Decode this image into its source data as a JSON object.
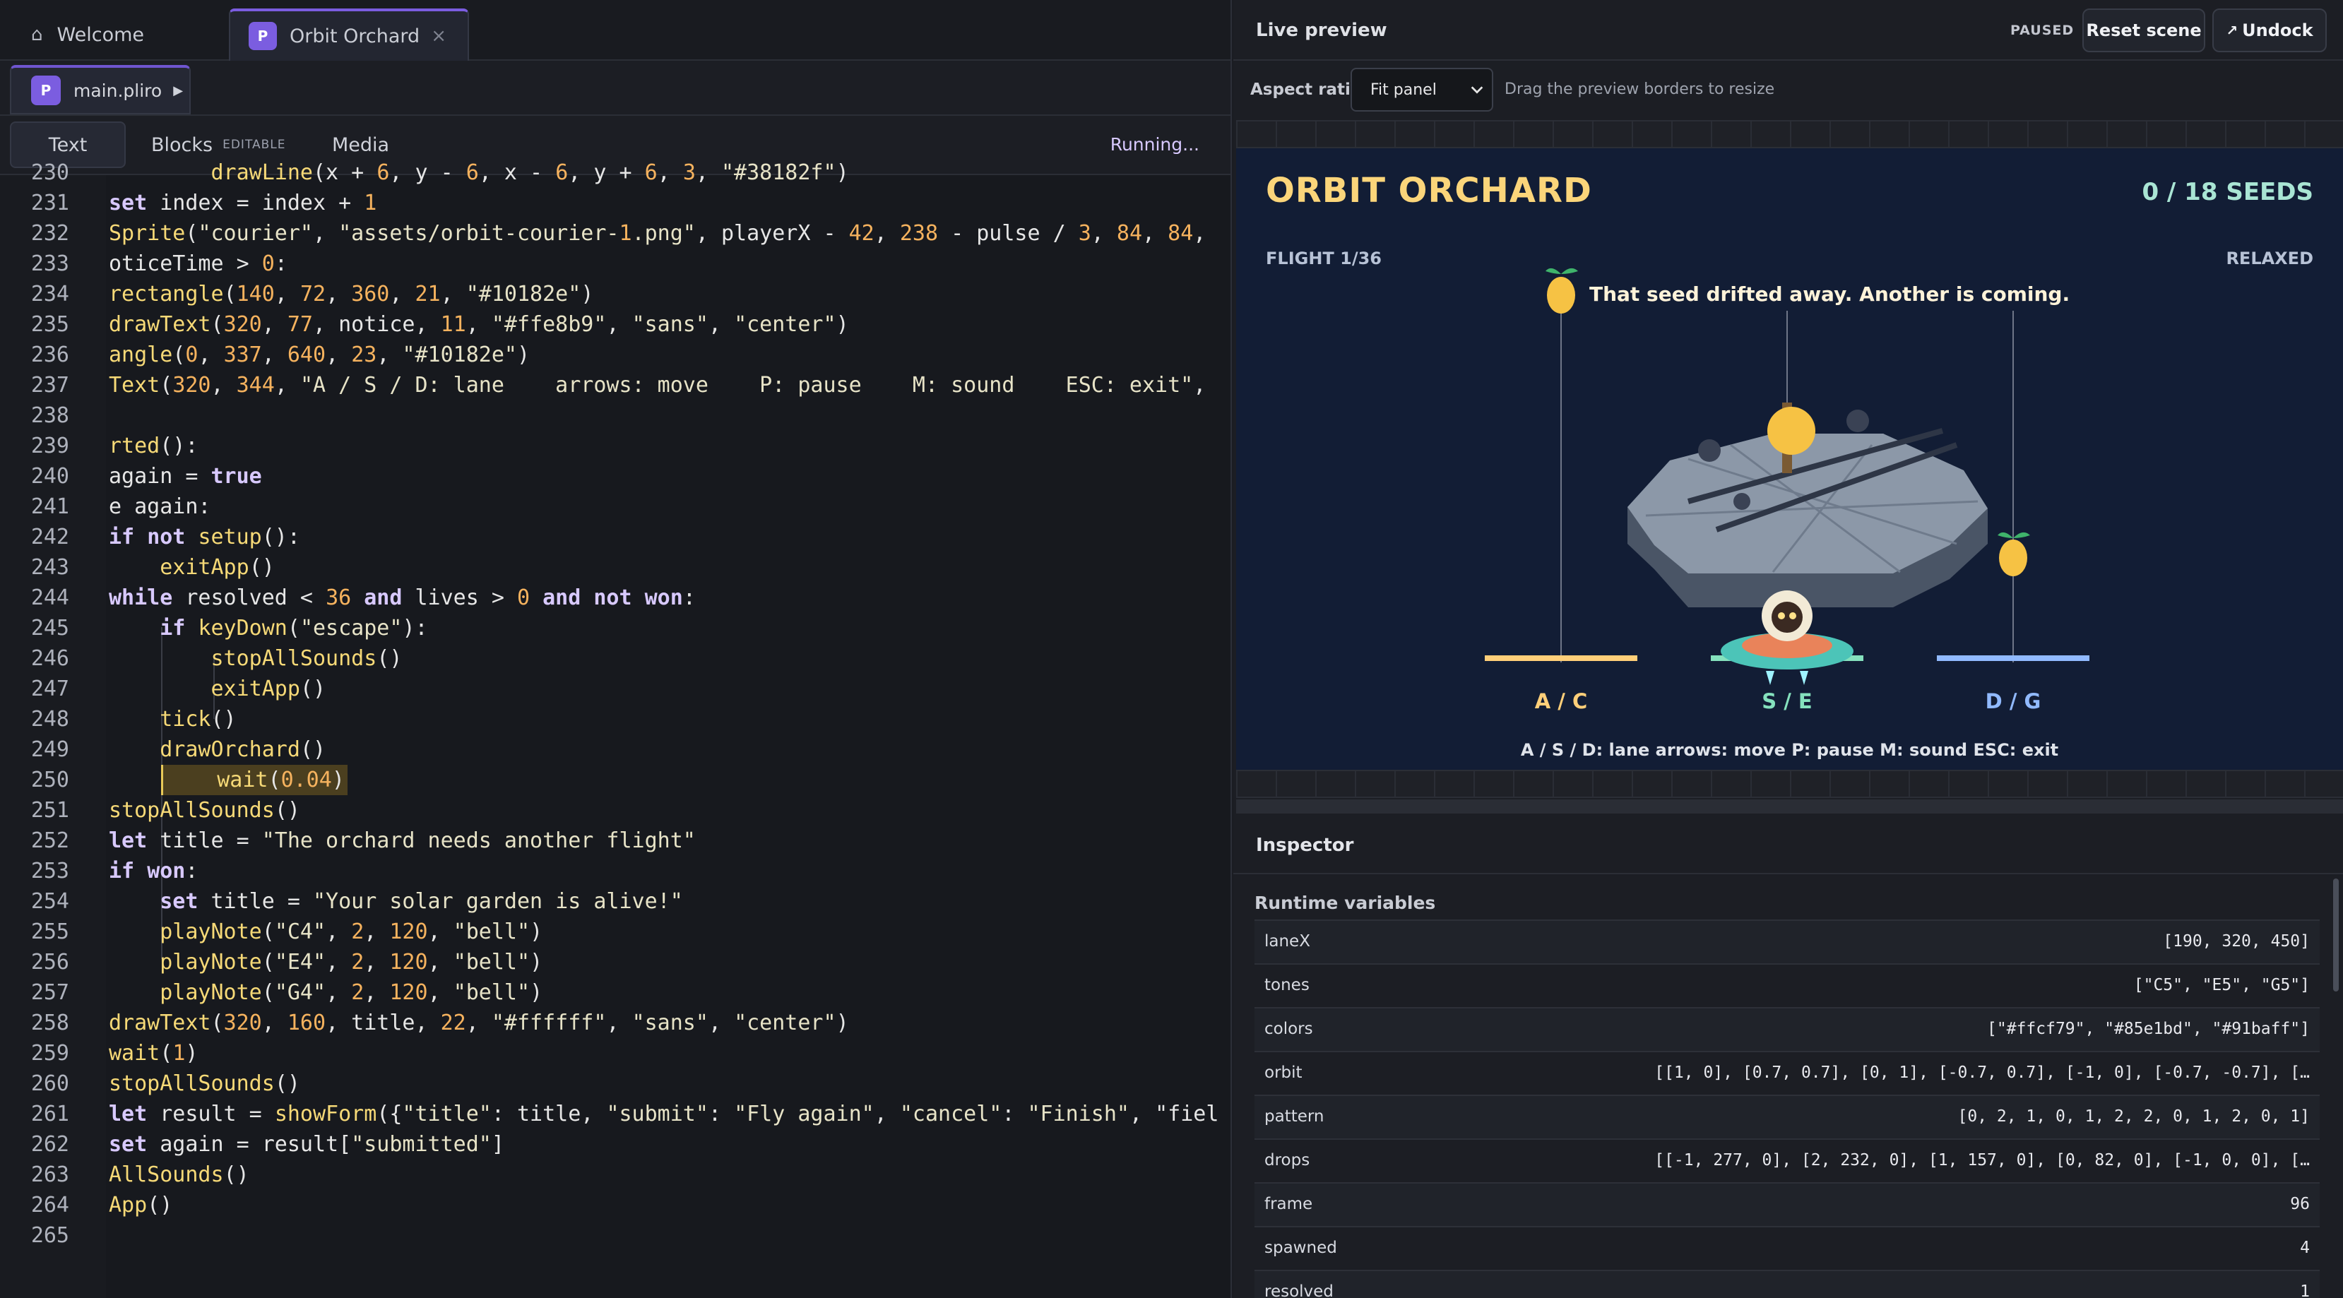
{
  "tabs": [
    {
      "label": "Welcome",
      "icon": "home-icon"
    },
    {
      "label": "Orbit Orchard",
      "badge": "P",
      "close": "×"
    }
  ],
  "file": {
    "name": "main.pliro",
    "badge": "P",
    "run_glyph": "▶"
  },
  "modes": {
    "text": "Text",
    "blocks": "Blocks",
    "blocks_badge": "EDITABLE",
    "media": "Media"
  },
  "status": "Running...",
  "code_lines": [
    {
      "n": "230",
      "t": "        drawLine(x + 6, y - 6, x - 6, y + 6, 3, \"#38182f\")"
    },
    {
      "n": "231",
      "t": "set index = index + 1"
    },
    {
      "n": "232",
      "t": "Sprite(\"courier\", \"assets/orbit-courier-1.png\", playerX - 42, 238 - pulse / 3, 84, 84,"
    },
    {
      "n": "233",
      "t": "oticeTime > 0:"
    },
    {
      "n": "234",
      "t": "rectangle(140, 72, 360, 21, \"#10182e\")"
    },
    {
      "n": "235",
      "t": "drawText(320, 77, notice, 11, \"#ffe8b9\", \"sans\", \"center\")"
    },
    {
      "n": "236",
      "t": "angle(0, 337, 640, 23, \"#10182e\")"
    },
    {
      "n": "237",
      "t": "Text(320, 344, \"A / S / D: lane    arrows: move    P: pause    M: sound    ESC: exit\","
    },
    {
      "n": "238",
      "t": ""
    },
    {
      "n": "239",
      "t": "rted():"
    },
    {
      "n": "240",
      "t": "again = true"
    },
    {
      "n": "241",
      "t": "e again:"
    },
    {
      "n": "242",
      "t": "if not setup():"
    },
    {
      "n": "243",
      "t": "    exitApp()"
    },
    {
      "n": "244",
      "t": "while resolved < 36 and lives > 0 and not won:"
    },
    {
      "n": "245",
      "t": "    if keyDown(\"escape\"):"
    },
    {
      "n": "246",
      "t": "        stopAllSounds()"
    },
    {
      "n": "247",
      "t": "        exitApp()"
    },
    {
      "n": "248",
      "t": "    tick()"
    },
    {
      "n": "249",
      "t": "    drawOrchard()"
    },
    {
      "n": "250",
      "t": "    wait(0.04)"
    },
    {
      "n": "251",
      "t": "stopAllSounds()"
    },
    {
      "n": "252",
      "t": "let title = \"The orchard needs another flight\""
    },
    {
      "n": "253",
      "t": "if won:"
    },
    {
      "n": "254",
      "t": "    set title = \"Your solar garden is alive!\""
    },
    {
      "n": "255",
      "t": "    playNote(\"C4\", 2, 120, \"bell\")"
    },
    {
      "n": "256",
      "t": "    playNote(\"E4\", 2, 120, \"bell\")"
    },
    {
      "n": "257",
      "t": "    playNote(\"G4\", 2, 120, \"bell\")"
    },
    {
      "n": "258",
      "t": "drawText(320, 160, title, 22, \"#ffffff\", \"sans\", \"center\")"
    },
    {
      "n": "259",
      "t": "wait(1)"
    },
    {
      "n": "260",
      "t": "stopAllSounds()"
    },
    {
      "n": "261",
      "t": "let result = showForm({\"title\": title, \"submit\": \"Fly again\", \"cancel\": \"Finish\", \"fiel"
    },
    {
      "n": "262",
      "t": "set again = result[\"submitted\"]"
    },
    {
      "n": "263",
      "t": "AllSounds()"
    },
    {
      "n": "264",
      "t": "App()"
    },
    {
      "n": "265",
      "t": ""
    }
  ],
  "preview": {
    "title": "Live preview",
    "paused": "PAUSED",
    "reset": "Reset scene",
    "undock": "Undock",
    "undock_icon": "pop-out-icon",
    "aspect_label": "Aspect ratio",
    "aspect_value": "Fit panel",
    "hint": "Drag the preview borders to resize"
  },
  "game": {
    "title": "ORBIT ORCHARD",
    "seeds": "0 / 18 SEEDS",
    "flight": "FLIGHT 1/36",
    "mode": "RELAXED",
    "notice": "That seed drifted away. Another is coming.",
    "help": "A / S / D: lane arrows: move P: pause M: sound ESC: exit",
    "lanes": [
      {
        "label": "A / C",
        "color": "#ffcf79"
      },
      {
        "label": "S / E",
        "color": "#85e1bd"
      },
      {
        "label": "D / G",
        "color": "#91baff"
      }
    ]
  },
  "inspector": {
    "title": "Inspector",
    "section": "Runtime variables",
    "vars": [
      {
        "k": "laneX",
        "v": "[190, 320, 450]"
      },
      {
        "k": "tones",
        "v": "[\"C5\", \"E5\", \"G5\"]"
      },
      {
        "k": "colors",
        "v": "[\"#ffcf79\", \"#85e1bd\", \"#91baff\"]"
      },
      {
        "k": "orbit",
        "v": "[[1, 0], [0.7, 0.7], [0, 1], [-0.7, 0.7], [-1, 0], [-0.7, -0.7], […"
      },
      {
        "k": "pattern",
        "v": "[0, 2, 1, 0, 1, 2, 2, 0, 1, 2, 0, 1]"
      },
      {
        "k": "drops",
        "v": "[[-1, 277, 0], [2, 232, 0], [1, 157, 0], [0, 82, 0], [-1, 0, 0], […"
      },
      {
        "k": "frame",
        "v": "96"
      },
      {
        "k": "spawned",
        "v": "4"
      },
      {
        "k": "resolved",
        "v": "1"
      }
    ]
  },
  "colors": {
    "accent": "#7b5de0",
    "paused_bg": "#121d35",
    "seed_gold": "#f6c244"
  }
}
